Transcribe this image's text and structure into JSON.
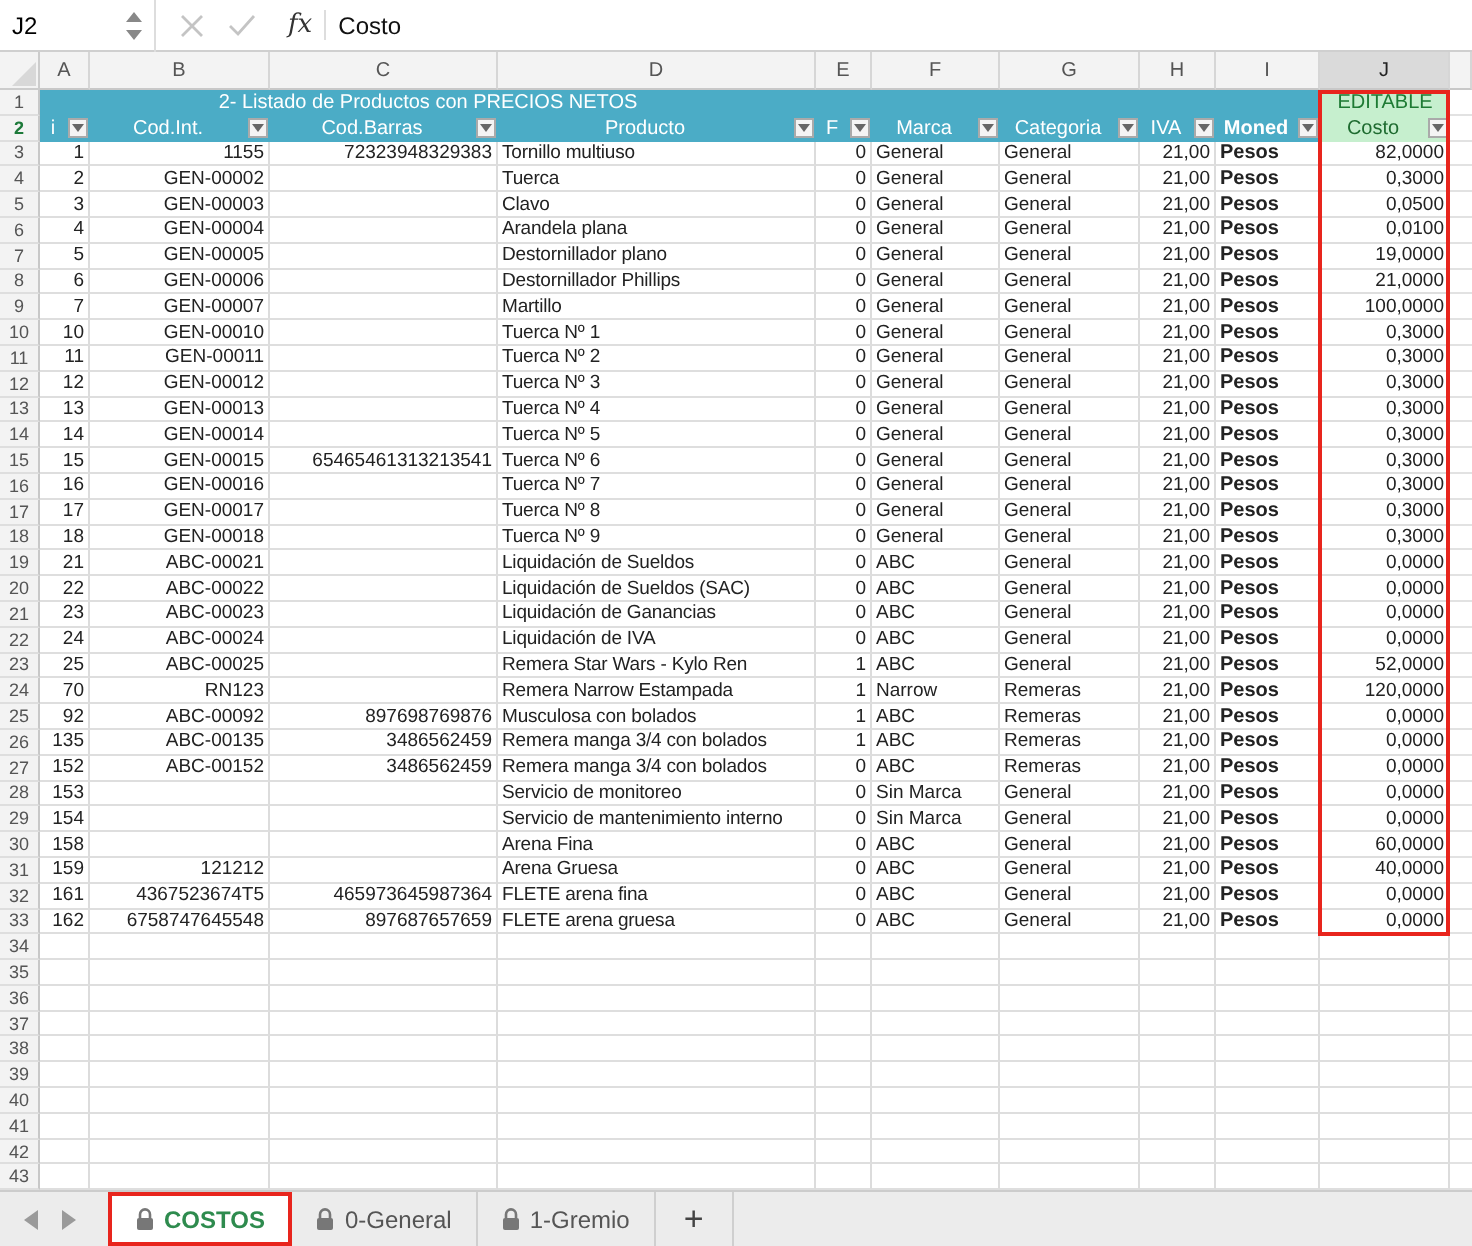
{
  "formula_bar": {
    "name_box": "J2",
    "function_label": "fx",
    "formula": "Costo"
  },
  "columns": [
    {
      "letter": "A",
      "selected": false,
      "highlighted": false
    },
    {
      "letter": "B",
      "selected": false,
      "highlighted": false
    },
    {
      "letter": "C",
      "selected": false,
      "highlighted": false
    },
    {
      "letter": "D",
      "selected": false,
      "highlighted": false
    },
    {
      "letter": "E",
      "selected": false,
      "highlighted": false
    },
    {
      "letter": "F",
      "selected": false,
      "highlighted": false
    },
    {
      "letter": "G",
      "selected": false,
      "highlighted": false
    },
    {
      "letter": "H",
      "selected": false,
      "highlighted": false
    },
    {
      "letter": "I",
      "selected": false,
      "highlighted": false
    },
    {
      "letter": "J",
      "selected": true,
      "highlighted": true
    }
  ],
  "header_rows": [
    {
      "number": "1",
      "selected": false
    },
    {
      "number": "2",
      "selected": true
    }
  ],
  "title": "2- Listado de Productos con PRECIOS NETOS",
  "editable_label": "EDITABLE",
  "headers": [
    {
      "label": "i",
      "kind": "standard"
    },
    {
      "label": "Cod.Int.",
      "kind": "standard"
    },
    {
      "label": "Cod.Barras",
      "kind": "standard"
    },
    {
      "label": "Producto",
      "kind": "standard"
    },
    {
      "label": "F",
      "kind": "standard"
    },
    {
      "label": "Marca",
      "kind": "standard"
    },
    {
      "label": "Categoria",
      "kind": "standard"
    },
    {
      "label": "IVA",
      "kind": "standard"
    },
    {
      "label": "Moned",
      "kind": "bold"
    },
    {
      "label": "Costo",
      "kind": "editable"
    }
  ],
  "rows": [
    {
      "row": "3",
      "id": "1",
      "cod_int": "1155",
      "cod_barras": "72323948329383",
      "producto": "Tornillo multiuso",
      "col_e": "0",
      "marca": "General",
      "categoria": "General",
      "iva": "21,00",
      "moneda": "Pesos",
      "costo": "82,0000"
    },
    {
      "row": "4",
      "id": "2",
      "cod_int": "GEN-00002",
      "producto": "Tuerca",
      "col_e": "0",
      "marca": "General",
      "categoria": "General",
      "iva": "21,00",
      "moneda": "Pesos",
      "costo": "0,3000"
    },
    {
      "row": "5",
      "id": "3",
      "cod_int": "GEN-00003",
      "producto": "Clavo",
      "col_e": "0",
      "marca": "General",
      "categoria": "General",
      "iva": "21,00",
      "moneda": "Pesos",
      "costo": "0,0500"
    },
    {
      "row": "6",
      "id": "4",
      "cod_int": "GEN-00004",
      "producto": "Arandela plana",
      "col_e": "0",
      "marca": "General",
      "categoria": "General",
      "iva": "21,00",
      "moneda": "Pesos",
      "costo": "0,0100"
    },
    {
      "row": "7",
      "id": "5",
      "cod_int": "GEN-00005",
      "producto": "Destornillador plano",
      "col_e": "0",
      "marca": "General",
      "categoria": "General",
      "iva": "21,00",
      "moneda": "Pesos",
      "costo": "19,0000"
    },
    {
      "row": "8",
      "id": "6",
      "cod_int": "GEN-00006",
      "producto": "Destornillador Phillips",
      "col_e": "0",
      "marca": "General",
      "categoria": "General",
      "iva": "21,00",
      "moneda": "Pesos",
      "costo": "21,0000"
    },
    {
      "row": "9",
      "id": "7",
      "cod_int": "GEN-00007",
      "producto": "Martillo",
      "col_e": "0",
      "marca": "General",
      "categoria": "General",
      "iva": "21,00",
      "moneda": "Pesos",
      "costo": "100,0000"
    },
    {
      "row": "10",
      "id": "10",
      "cod_int": "GEN-00010",
      "producto": "Tuerca Nº 1",
      "col_e": "0",
      "marca": "General",
      "categoria": "General",
      "iva": "21,00",
      "moneda": "Pesos",
      "costo": "0,3000"
    },
    {
      "row": "11",
      "id": "11",
      "cod_int": "GEN-00011",
      "producto": "Tuerca Nº 2",
      "col_e": "0",
      "marca": "General",
      "categoria": "General",
      "iva": "21,00",
      "moneda": "Pesos",
      "costo": "0,3000"
    },
    {
      "row": "12",
      "id": "12",
      "cod_int": "GEN-00012",
      "producto": "Tuerca Nº 3",
      "col_e": "0",
      "marca": "General",
      "categoria": "General",
      "iva": "21,00",
      "moneda": "Pesos",
      "costo": "0,3000"
    },
    {
      "row": "13",
      "id": "13",
      "cod_int": "GEN-00013",
      "producto": "Tuerca Nº 4",
      "col_e": "0",
      "marca": "General",
      "categoria": "General",
      "iva": "21,00",
      "moneda": "Pesos",
      "costo": "0,3000"
    },
    {
      "row": "14",
      "id": "14",
      "cod_int": "GEN-00014",
      "producto": "Tuerca Nº 5",
      "col_e": "0",
      "marca": "General",
      "categoria": "General",
      "iva": "21,00",
      "moneda": "Pesos",
      "costo": "0,3000"
    },
    {
      "row": "15",
      "id": "15",
      "cod_int": "GEN-00015",
      "cod_barras": "65465461313213541",
      "producto": "Tuerca Nº 6",
      "col_e": "0",
      "marca": "General",
      "categoria": "General",
      "iva": "21,00",
      "moneda": "Pesos",
      "costo": "0,3000"
    },
    {
      "row": "16",
      "id": "16",
      "cod_int": "GEN-00016",
      "producto": "Tuerca Nº 7",
      "col_e": "0",
      "marca": "General",
      "categoria": "General",
      "iva": "21,00",
      "moneda": "Pesos",
      "costo": "0,3000"
    },
    {
      "row": "17",
      "id": "17",
      "cod_int": "GEN-00017",
      "producto": "Tuerca Nº 8",
      "col_e": "0",
      "marca": "General",
      "categoria": "General",
      "iva": "21,00",
      "moneda": "Pesos",
      "costo": "0,3000"
    },
    {
      "row": "18",
      "id": "18",
      "cod_int": "GEN-00018",
      "producto": "Tuerca Nº 9",
      "col_e": "0",
      "marca": "General",
      "categoria": "General",
      "iva": "21,00",
      "moneda": "Pesos",
      "costo": "0,3000"
    },
    {
      "row": "19",
      "id": "21",
      "cod_int": "ABC-00021",
      "producto": "Liquidación de Sueldos",
      "col_e": "0",
      "marca": "ABC",
      "categoria": "General",
      "iva": "21,00",
      "moneda": "Pesos",
      "costo": "0,0000"
    },
    {
      "row": "20",
      "id": "22",
      "cod_int": "ABC-00022",
      "producto": "Liquidación de Sueldos (SAC)",
      "col_e": "0",
      "marca": "ABC",
      "categoria": "General",
      "iva": "21,00",
      "moneda": "Pesos",
      "costo": "0,0000"
    },
    {
      "row": "21",
      "id": "23",
      "cod_int": "ABC-00023",
      "producto": "Liquidación de Ganancias",
      "col_e": "0",
      "marca": "ABC",
      "categoria": "General",
      "iva": "21,00",
      "moneda": "Pesos",
      "costo": "0,0000"
    },
    {
      "row": "22",
      "id": "24",
      "cod_int": "ABC-00024",
      "producto": "Liquidación de IVA",
      "col_e": "0",
      "marca": "ABC",
      "categoria": "General",
      "iva": "21,00",
      "moneda": "Pesos",
      "costo": "0,0000"
    },
    {
      "row": "23",
      "id": "25",
      "cod_int": "ABC-00025",
      "producto": "Remera Star Wars - Kylo Ren",
      "col_e": "1",
      "marca": "ABC",
      "categoria": "General",
      "iva": "21,00",
      "moneda": "Pesos",
      "costo": "52,0000"
    },
    {
      "row": "24",
      "id": "70",
      "cod_int": "RN123",
      "producto": "Remera Narrow Estampada",
      "col_e": "1",
      "marca": "Narrow",
      "categoria": "Remeras",
      "iva": "21,00",
      "moneda": "Pesos",
      "costo": "120,0000"
    },
    {
      "row": "25",
      "id": "92",
      "cod_int": "ABC-00092",
      "cod_barras": "897698769876",
      "producto": "Musculosa con bolados",
      "col_e": "1",
      "marca": "ABC",
      "categoria": "Remeras",
      "iva": "21,00",
      "moneda": "Pesos",
      "costo": "0,0000"
    },
    {
      "row": "26",
      "id": "135",
      "cod_int": "ABC-00135",
      "cod_barras": "3486562459",
      "producto": "Remera manga 3/4 con bolados",
      "col_e": "1",
      "marca": "ABC",
      "categoria": "Remeras",
      "iva": "21,00",
      "moneda": "Pesos",
      "costo": "0,0000"
    },
    {
      "row": "27",
      "id": "152",
      "cod_int": "ABC-00152",
      "cod_barras": "3486562459",
      "producto": "Remera manga 3/4 con bolados",
      "col_e": "0",
      "marca": "ABC",
      "categoria": "Remeras",
      "iva": "21,00",
      "moneda": "Pesos",
      "costo": "0,0000"
    },
    {
      "row": "28",
      "id": "153",
      "producto": "Servicio de monitoreo",
      "col_e": "0",
      "marca": "Sin Marca",
      "categoria": "General",
      "iva": "21,00",
      "moneda": "Pesos",
      "costo": "0,0000"
    },
    {
      "row": "29",
      "id": "154",
      "producto": "Servicio de mantenimiento interno",
      "col_e": "0",
      "marca": "Sin Marca",
      "categoria": "General",
      "iva": "21,00",
      "moneda": "Pesos",
      "costo": "0,0000"
    },
    {
      "row": "30",
      "id": "158",
      "producto": "Arena Fina",
      "col_e": "0",
      "marca": "ABC",
      "categoria": "General",
      "iva": "21,00",
      "moneda": "Pesos",
      "costo": "60,0000"
    },
    {
      "row": "31",
      "id": "159",
      "cod_int": "121212",
      "producto": "Arena Gruesa",
      "col_e": "0",
      "marca": "ABC",
      "categoria": "General",
      "iva": "21,00",
      "moneda": "Pesos",
      "costo": "40,0000"
    },
    {
      "row": "32",
      "id": "161",
      "cod_int": "4367523674T5",
      "cod_barras": "465973645987364",
      "producto": "FLETE arena fina",
      "col_e": "0",
      "marca": "ABC",
      "categoria": "General",
      "iva": "21,00",
      "moneda": "Pesos",
      "costo": "0,0000"
    },
    {
      "row": "33",
      "id": "162",
      "cod_int": "6758747645548",
      "cod_barras": "897687657659",
      "producto": "FLETE arena gruesa",
      "col_e": "0",
      "marca": "ABC",
      "categoria": "General",
      "iva": "21,00",
      "moneda": "Pesos",
      "costo": "0,0000"
    }
  ],
  "empty_rows": [
    "34",
    "35",
    "36",
    "37",
    "38",
    "39",
    "40",
    "41",
    "42",
    "43"
  ],
  "sheet_tabs": [
    {
      "label": "COSTOS",
      "selected": true,
      "locked": true,
      "highlighted": true
    },
    {
      "label": "0-General",
      "selected": false,
      "locked": true,
      "highlighted": false
    },
    {
      "label": "1-Gremio",
      "selected": false,
      "locked": true,
      "highlighted": false
    }
  ],
  "add_sheet": "+"
}
